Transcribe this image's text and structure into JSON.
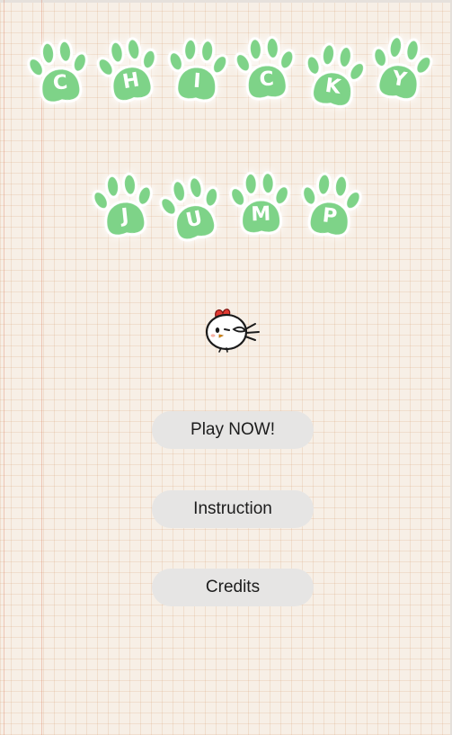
{
  "title": {
    "line1": [
      "C",
      "H",
      "I",
      "C",
      "K",
      "Y"
    ],
    "line2": [
      "J",
      "U",
      "M",
      "P"
    ]
  },
  "colors": {
    "paw": "#7ed388",
    "background": "#f7efe6",
    "button": "#e6e5e4"
  },
  "icons": {
    "paw": "paw-print-icon",
    "mascot": "chicken-mascot-icon"
  },
  "menu": {
    "play_label": "Play NOW!",
    "instruction_label": "Instruction",
    "credits_label": "Credits"
  }
}
